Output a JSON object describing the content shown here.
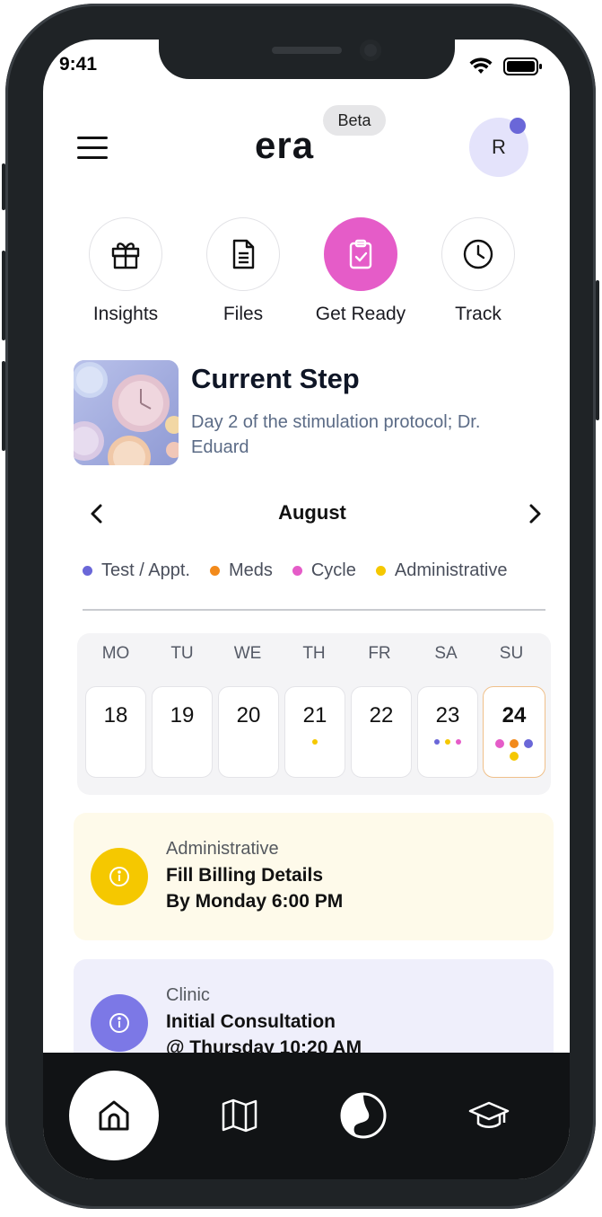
{
  "status_bar": {
    "time": "9:41"
  },
  "header": {
    "logo": "era",
    "badge": "Beta",
    "avatar_initial": "R"
  },
  "quick_actions": [
    {
      "label": "Insights",
      "icon": "gift-icon"
    },
    {
      "label": "Files",
      "icon": "document-icon"
    },
    {
      "label": "Get Ready",
      "icon": "clipboard-check-icon",
      "active": true
    },
    {
      "label": "Track",
      "icon": "clock-icon"
    }
  ],
  "current_step": {
    "title": "Current Step",
    "subtitle": "Day 2 of the stimulation protocol; Dr. Eduard"
  },
  "calendar": {
    "month": "August",
    "legend": [
      {
        "label": "Test / Appt.",
        "color": "#6a67d8"
      },
      {
        "label": "Meds",
        "color": "#f28a1b"
      },
      {
        "label": "Cycle",
        "color": "#e55cc8"
      },
      {
        "label": "Administrative",
        "color": "#f5c800"
      }
    ],
    "weekdays": [
      "MO",
      "TU",
      "WE",
      "TH",
      "FR",
      "SA",
      "SU"
    ],
    "days": [
      {
        "num": "18",
        "dots": []
      },
      {
        "num": "19",
        "dots": []
      },
      {
        "num": "20",
        "dots": []
      },
      {
        "num": "21",
        "dots": [
          "#f5c800"
        ]
      },
      {
        "num": "22",
        "dots": []
      },
      {
        "num": "23",
        "dots": [
          "#6a67d8",
          "#f5c800",
          "#e55cc8"
        ]
      },
      {
        "num": "24",
        "dots": [
          "#e55cc8",
          "#f28a1b",
          "#6a67d8",
          "#f5c800"
        ],
        "selected": true
      }
    ]
  },
  "tasks": [
    {
      "category": "Administrative",
      "title": "Fill Billing Details",
      "detail": "By Monday 6:00 PM",
      "bg": "#fefaea",
      "icon_color": "#f5c800"
    },
    {
      "category": "Clinic",
      "title": "Initial Consultation",
      "detail": "@ Thursday 10:20 AM",
      "bg": "#efeffb",
      "icon_color": "#7c78e6"
    }
  ],
  "bottom_nav": [
    {
      "icon": "home-icon",
      "active": true
    },
    {
      "icon": "map-icon"
    },
    {
      "icon": "cycle-icon"
    },
    {
      "icon": "graduation-cap-icon"
    }
  ]
}
